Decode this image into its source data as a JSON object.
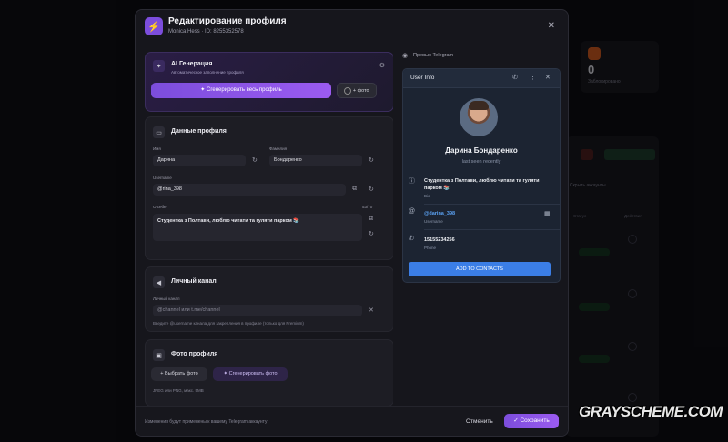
{
  "background": {
    "stat_value": "0",
    "stat_label": "Заблокировано",
    "table_headers": [
      "Статус",
      "Действия"
    ],
    "status_pill": "Работает",
    "filter_label": "Скрыть аккаунты"
  },
  "modal": {
    "title": "Редактирование профиля",
    "subtitle": "Monica Hess · ID: 8255352578",
    "ai": {
      "title": "AI Генерация",
      "subtitle": "Автоматическое заполнение профиля",
      "generate_button": "Сгенерировать весь профиль",
      "photo_button": "+ фото"
    },
    "profile": {
      "title": "Данные профиля",
      "first_name_label": "Имя",
      "first_name_value": "Дарина",
      "last_name_label": "Фамилия",
      "last_name_value": "Бондаренко",
      "username_label": "Username",
      "username_value": "@rina_398",
      "about_label": "О себе",
      "about_counter": "53/70",
      "about_value": "Студентка з Полтави, люблю читати та гуляти парком 📚"
    },
    "channel": {
      "title": "Личный канал",
      "field_label": "Личный канал",
      "placeholder": "@channel или t.me/channel",
      "hint": "Введите @username канала для закрепления в профиле (только для Premium)"
    },
    "photo": {
      "title": "Фото профиля",
      "choose_button": "Выбрать фото",
      "generate_button": "Сгенерировать фото",
      "hint": "JPEG или PNG, макс. 5MB"
    },
    "preview": {
      "label": "Превью Telegram",
      "header_title": "User Info",
      "name": "Дарина Бондаренко",
      "last_seen": "last seen recently",
      "bio": "Студентка з Полтави, люблю читати та гуляти парком 📚",
      "bio_label": "Bio",
      "username": "@darina_398",
      "username_label": "Username",
      "phone": "15155234256",
      "phone_label": "Phone",
      "add_button": "ADD TO CONTACTS"
    },
    "footer": {
      "hint": "Изменения будут применены к вашему Telegram аккаунту",
      "cancel": "Отменить",
      "save": "Сохранить"
    }
  },
  "watermark": "GRAYSCHEME.COM",
  "colors": {
    "accent": "#8b55e8",
    "telegram_blue": "#3b7ee6",
    "link_blue": "#5aa0f0"
  }
}
